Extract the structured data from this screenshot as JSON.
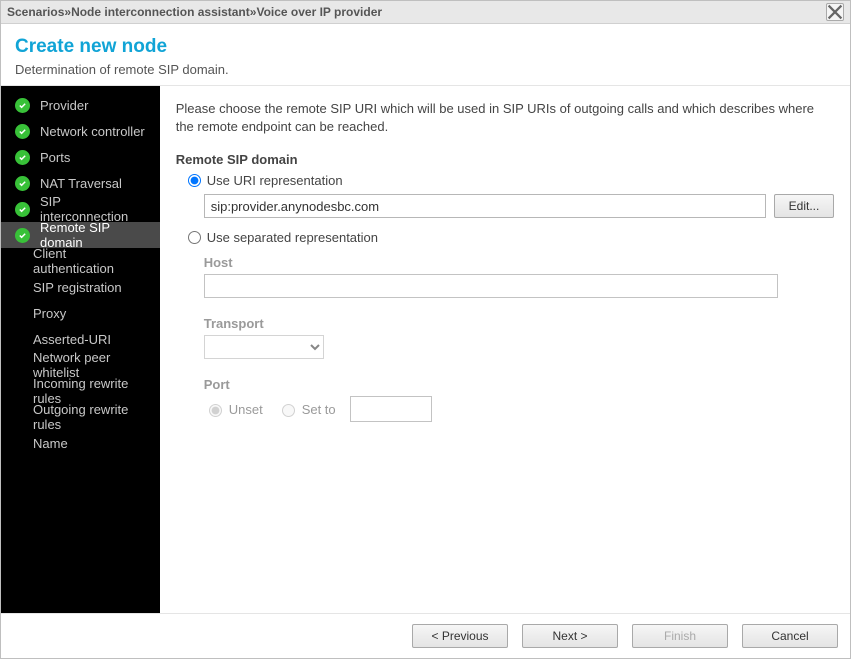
{
  "breadcrumb": {
    "a": "Scenarios",
    "b": "Node interconnection assistant",
    "c": "Voice over IP provider",
    "sep": " » "
  },
  "header": {
    "title": "Create new node",
    "subtitle": "Determination of remote SIP domain."
  },
  "sidebar": {
    "items": [
      {
        "label": "Provider",
        "done": true
      },
      {
        "label": "Network controller",
        "done": true
      },
      {
        "label": "Ports",
        "done": true
      },
      {
        "label": "NAT Traversal",
        "done": true
      },
      {
        "label": "SIP interconnection",
        "done": true
      },
      {
        "label": "Remote SIP domain",
        "done": true,
        "active": true
      },
      {
        "label": "Client authentication",
        "done": false
      },
      {
        "label": "SIP registration",
        "done": false
      },
      {
        "label": "Proxy",
        "done": false
      },
      {
        "label": "Asserted-URI",
        "done": false
      },
      {
        "label": "Network peer whitelist",
        "done": false
      },
      {
        "label": "Incoming rewrite rules",
        "done": false
      },
      {
        "label": "Outgoing rewrite rules",
        "done": false
      },
      {
        "label": "Name",
        "done": false
      }
    ]
  },
  "main": {
    "intro": "Please choose the remote SIP URI which will be used in SIP URIs of outgoing calls and which describes where the remote endpoint can be reached.",
    "section_title": "Remote SIP domain",
    "radio_uri": "Use URI representation",
    "uri_value": "sip:provider.anynodesbc.com",
    "edit_button": "Edit...",
    "radio_sep": "Use separated representation",
    "host_label": "Host",
    "transport_label": "Transport",
    "port_label": "Port",
    "port_unset": "Unset",
    "port_setto": "Set to"
  },
  "footer": {
    "previous": "< Previous",
    "next": "Next >",
    "finish": "Finish",
    "cancel": "Cancel"
  }
}
